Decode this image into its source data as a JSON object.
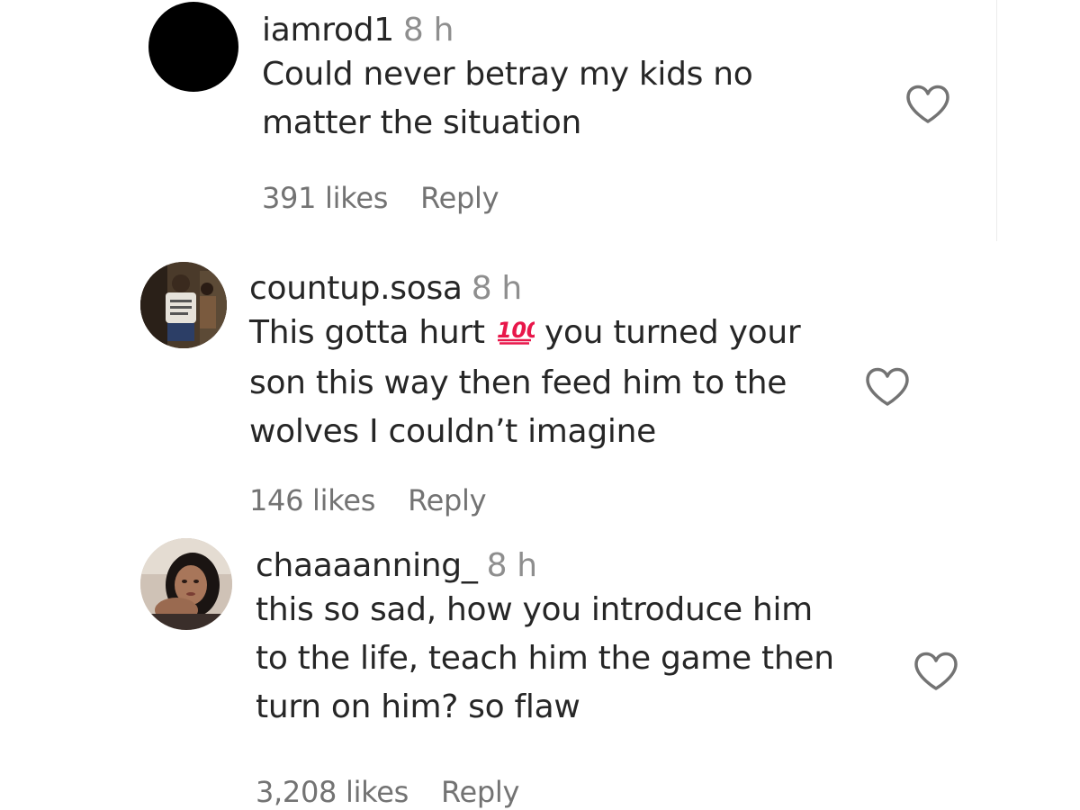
{
  "comments": [
    {
      "username": "iamrod1",
      "time": "8 h",
      "lines": [
        "Could never betray my kids no",
        "matter the situation"
      ],
      "likes": "391 likes",
      "reply": "Reply"
    },
    {
      "username": "countup.sosa",
      "time": "8 h",
      "line1_before": "This gotta hurt ",
      "line1_emoji": "💯",
      "line1_after": " you turned your",
      "lines": [
        "son this way then feed him to the",
        "wolves I couldn’t imagine"
      ],
      "likes": "146 likes",
      "reply": "Reply"
    },
    {
      "username": "chaaaanning_",
      "time": "8 h",
      "lines": [
        "this so sad, how you introduce him",
        "to the life, teach him the game then",
        "turn on him? so flaw"
      ],
      "likes": "3,208 likes",
      "reply": "Reply"
    }
  ],
  "icons": {
    "like": "heart-outline-icon",
    "emoji": "hundred-points-emoji"
  },
  "colors": {
    "text": "#262626",
    "secondary": "#8e8e8e",
    "meta": "#737373",
    "heart_stroke": "#737373",
    "emoji_red": "#e8174a"
  }
}
